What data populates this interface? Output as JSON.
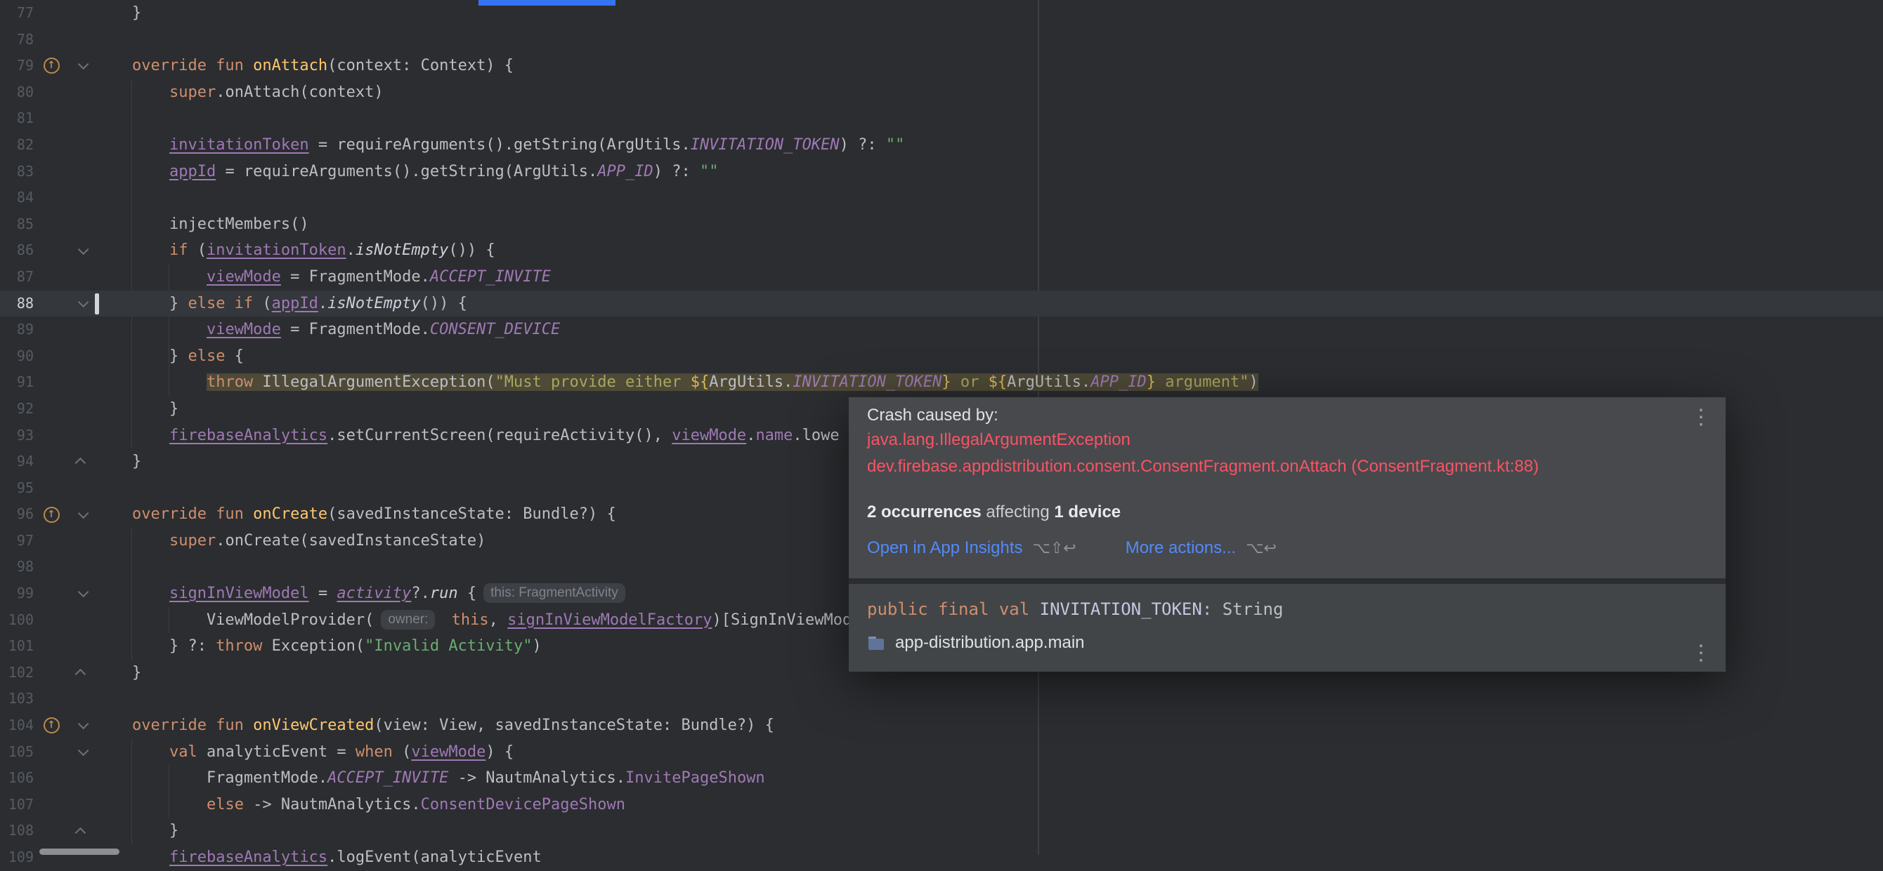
{
  "colors": {
    "background": "#2b2d30",
    "caret_line": "#34373c",
    "keyword": "#cf8e6d",
    "string": "#6aab73",
    "field": "#9f79b5",
    "error_red": "#f75464",
    "link_blue": "#548af7",
    "crash_line_highlight": "#4e4a37",
    "accent_blue": "#3574f0"
  },
  "editor": {
    "override_icon": "↑",
    "lines": [
      {
        "n": 77,
        "segs": [
          [
            "pl",
            "    }"
          ]
        ]
      },
      {
        "n": 78,
        "segs": []
      },
      {
        "n": 79,
        "g": "ovr",
        "f": "d",
        "segs": [
          [
            "pl",
            "    "
          ],
          [
            "kw",
            "override fun "
          ],
          [
            "fn",
            "onAttach"
          ],
          [
            "pl",
            "(context: Context) {"
          ]
        ]
      },
      {
        "n": 80,
        "segs": [
          [
            "pl",
            "        "
          ],
          [
            "kw",
            "super"
          ],
          [
            "pl",
            ".onAttach(context)"
          ]
        ]
      },
      {
        "n": 81,
        "segs": []
      },
      {
        "n": 82,
        "segs": [
          [
            "pl",
            "        "
          ],
          [
            "fld",
            "invitationToken"
          ],
          [
            "pl",
            " = requireArguments().getString(ArgUtils."
          ],
          [
            "const",
            "INVITATION_TOKEN"
          ],
          [
            "pl",
            ") ?: "
          ],
          [
            "str",
            "\"\""
          ]
        ]
      },
      {
        "n": 83,
        "segs": [
          [
            "pl",
            "        "
          ],
          [
            "fld",
            "appId"
          ],
          [
            "pl",
            " = requireArguments().getString(ArgUtils."
          ],
          [
            "const",
            "APP_ID"
          ],
          [
            "pl",
            ") ?: "
          ],
          [
            "str",
            "\"\""
          ]
        ]
      },
      {
        "n": 84,
        "segs": []
      },
      {
        "n": 85,
        "segs": [
          [
            "pl",
            "        injectMembers()"
          ]
        ]
      },
      {
        "n": 86,
        "f": "d",
        "segs": [
          [
            "pl",
            "        "
          ],
          [
            "kw",
            "if"
          ],
          [
            "pl",
            " ("
          ],
          [
            "fld",
            "invitationToken"
          ],
          [
            "pl",
            "."
          ],
          [
            "ext",
            "isNotEmpty"
          ],
          [
            "pl",
            "()) {"
          ]
        ]
      },
      {
        "n": 87,
        "segs": [
          [
            "pl",
            "            "
          ],
          [
            "fld",
            "viewMode"
          ],
          [
            "pl",
            " = FragmentMode."
          ],
          [
            "const",
            "ACCEPT_INVITE"
          ]
        ]
      },
      {
        "n": 88,
        "f": "d",
        "cur": true,
        "caret": true,
        "segs": [
          [
            "pl",
            "        } "
          ],
          [
            "kw",
            "else if"
          ],
          [
            "pl",
            " ("
          ],
          [
            "fld",
            "appId"
          ],
          [
            "pl",
            "."
          ],
          [
            "ext",
            "isNotEmpty"
          ],
          [
            "pl",
            "()) {"
          ]
        ]
      },
      {
        "n": 89,
        "segs": [
          [
            "pl",
            "            "
          ],
          [
            "fld",
            "viewMode"
          ],
          [
            "pl",
            " = FragmentMode."
          ],
          [
            "const",
            "CONSENT_DEVICE"
          ]
        ]
      },
      {
        "n": 90,
        "segs": [
          [
            "pl",
            "        } "
          ],
          [
            "kw",
            "else"
          ],
          [
            "pl",
            " {"
          ]
        ]
      },
      {
        "n": 91,
        "segs": [
          [
            "pl",
            "            "
          ],
          [
            "kw hl",
            "throw"
          ],
          [
            "pl hl",
            " IllegalArgumentException("
          ],
          [
            "str hl",
            "\"Must provide either "
          ],
          [
            "tpl hl",
            "${"
          ],
          [
            "pl hl",
            "ArgUtils."
          ],
          [
            "const hl",
            "INVITATION_TOKEN"
          ],
          [
            "tpl hl",
            "}"
          ],
          [
            "str hl",
            " or "
          ],
          [
            "tpl hl",
            "${"
          ],
          [
            "pl hl",
            "ArgUtils."
          ],
          [
            "const hl",
            "APP_ID"
          ],
          [
            "tpl hl",
            "}"
          ],
          [
            "str hl",
            " argument\""
          ],
          [
            "pl hl",
            ")"
          ]
        ]
      },
      {
        "n": 92,
        "segs": [
          [
            "pl",
            "        }"
          ]
        ]
      },
      {
        "n": 93,
        "segs": [
          [
            "pl",
            "        "
          ],
          [
            "fld",
            "firebaseAnalytics"
          ],
          [
            "pl",
            ".setCurrentScreen(requireActivity(), "
          ],
          [
            "fld",
            "viewMode"
          ],
          [
            "pl",
            "."
          ],
          [
            "prop",
            "name"
          ],
          [
            "pl",
            ".lowe"
          ]
        ]
      },
      {
        "n": 94,
        "f": "u",
        "segs": [
          [
            "pl",
            "    }"
          ]
        ]
      },
      {
        "n": 95,
        "segs": []
      },
      {
        "n": 96,
        "g": "ovr",
        "f": "d",
        "segs": [
          [
            "pl",
            "    "
          ],
          [
            "kw",
            "override fun "
          ],
          [
            "fn",
            "onCreate"
          ],
          [
            "pl",
            "(savedInstanceState: Bundle?) {"
          ]
        ]
      },
      {
        "n": 97,
        "segs": [
          [
            "pl",
            "        "
          ],
          [
            "kw",
            "super"
          ],
          [
            "pl",
            ".onCreate(savedInstanceState)"
          ]
        ]
      },
      {
        "n": 98,
        "segs": []
      },
      {
        "n": 99,
        "f": "d",
        "segs": [
          [
            "pl",
            "        "
          ],
          [
            "fld",
            "signInViewModel"
          ],
          [
            "pl",
            " = "
          ],
          [
            "acti",
            "activity"
          ],
          [
            "pl",
            "?."
          ],
          [
            "ext",
            "run"
          ],
          [
            "pl",
            " {"
          ],
          [
            "hint",
            "this: FragmentActivity"
          ]
        ]
      },
      {
        "n": 100,
        "segs": [
          [
            "pl",
            "            ViewModelProvider("
          ],
          [
            "hint",
            "owner:"
          ],
          [
            "pl",
            " "
          ],
          [
            "kw",
            "this"
          ],
          [
            "pl",
            ", "
          ],
          [
            "fld",
            "signInViewModelFactory"
          ],
          [
            "pl",
            ")[SignInViewMod"
          ]
        ]
      },
      {
        "n": 101,
        "segs": [
          [
            "pl",
            "        } ?: "
          ],
          [
            "kw",
            "throw"
          ],
          [
            "pl",
            " Exception("
          ],
          [
            "str",
            "\"Invalid Activity\""
          ],
          [
            "pl",
            ")"
          ]
        ]
      },
      {
        "n": 102,
        "f": "u",
        "segs": [
          [
            "pl",
            "    }"
          ]
        ]
      },
      {
        "n": 103,
        "segs": []
      },
      {
        "n": 104,
        "g": "ovr",
        "f": "d",
        "segs": [
          [
            "pl",
            "    "
          ],
          [
            "kw",
            "override fun "
          ],
          [
            "fn",
            "onViewCreated"
          ],
          [
            "pl",
            "(view: View, savedInstanceState: Bundle?) {"
          ]
        ]
      },
      {
        "n": 105,
        "f": "d",
        "segs": [
          [
            "pl",
            "        "
          ],
          [
            "kw",
            "val"
          ],
          [
            "pl",
            " analyticEvent = "
          ],
          [
            "kw",
            "when"
          ],
          [
            "pl",
            " ("
          ],
          [
            "fld",
            "viewMode"
          ],
          [
            "pl",
            ") {"
          ]
        ]
      },
      {
        "n": 106,
        "segs": [
          [
            "pl",
            "            FragmentMode."
          ],
          [
            "const",
            "ACCEPT_INVITE"
          ],
          [
            "pl",
            " -> NautmAnalytics."
          ],
          [
            "prop",
            "InvitePageShown"
          ]
        ]
      },
      {
        "n": 107,
        "segs": [
          [
            "pl",
            "            "
          ],
          [
            "kw",
            "else"
          ],
          [
            "pl",
            " -> NautmAnalytics."
          ],
          [
            "prop",
            "ConsentDevicePageShown"
          ]
        ]
      },
      {
        "n": 108,
        "f": "u",
        "segs": [
          [
            "pl",
            "        }"
          ]
        ]
      },
      {
        "n": 109,
        "segs": [
          [
            "pl",
            "        "
          ],
          [
            "fld",
            "firebaseAnalytics"
          ],
          [
            "pl",
            ".logEvent(analyticEvent"
          ]
        ]
      }
    ]
  },
  "popup": {
    "kebab_icon": "⋮",
    "crash": {
      "title": "Crash caused by:",
      "exception": "java.lang.IllegalArgumentException",
      "location": "dev.firebase.appdistribution.consent.ConsentFragment.onAttach (ConsentFragment.kt:88)",
      "occurrences_count": "2 occurrences",
      "occurrences_mid": " affecting ",
      "devices_count": "1 device",
      "open_link": "Open in App Insights",
      "open_shortcut": "⌥⇧↩",
      "more_link": "More actions...",
      "more_shortcut": "⌥↩"
    },
    "declaration": {
      "modifiers": "public final val ",
      "name": "INVITATION_TOKEN",
      "type": ": String",
      "module": "app-distribution.app.main"
    }
  }
}
